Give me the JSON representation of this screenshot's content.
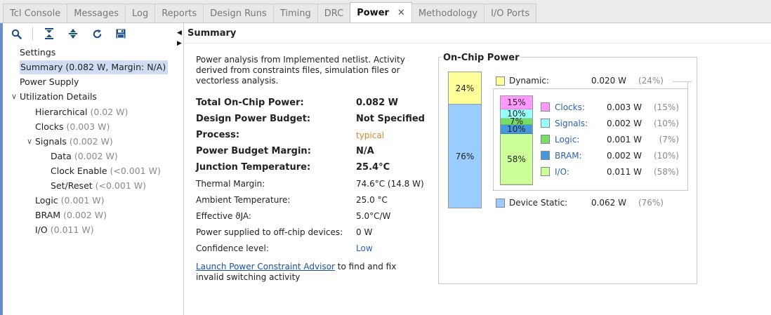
{
  "tabs": [
    {
      "label": "Tcl Console",
      "active": false
    },
    {
      "label": "Messages",
      "active": false
    },
    {
      "label": "Log",
      "active": false
    },
    {
      "label": "Reports",
      "active": false
    },
    {
      "label": "Design Runs",
      "active": false
    },
    {
      "label": "Timing",
      "active": false
    },
    {
      "label": "DRC",
      "active": false
    },
    {
      "label": "Power",
      "active": true
    },
    {
      "label": "Methodology",
      "active": false
    },
    {
      "label": "I/O Ports",
      "active": false
    }
  ],
  "tab_close_glyph": "✕",
  "toolbar": {
    "icons": [
      "search-icon",
      "collapse-all-icon",
      "expand-all-icon",
      "refresh-icon",
      "save-icon"
    ]
  },
  "tree": {
    "settings": {
      "label": "Settings"
    },
    "summary": {
      "label": "Summary (0.082 W, Margin: N/A)"
    },
    "power_supply": {
      "label": "Power Supply"
    },
    "utilization": {
      "label": "Utilization Details"
    },
    "hierarchical": {
      "label": "Hierarchical",
      "value": "(0.02 W)"
    },
    "clocks": {
      "label": "Clocks",
      "value": "(0.003 W)"
    },
    "signals": {
      "label": "Signals",
      "value": "(0.002 W)"
    },
    "data": {
      "label": "Data",
      "value": "(0.002 W)"
    },
    "clock_enable": {
      "label": "Clock Enable",
      "value": "(<0.001 W)"
    },
    "set_reset": {
      "label": "Set/Reset",
      "value": "(<0.001 W)"
    },
    "logic": {
      "label": "Logic",
      "value": "(0.001 W)"
    },
    "bram": {
      "label": "BRAM",
      "value": "(0.002 W)"
    },
    "io": {
      "label": "I/O",
      "value": "(0.011 W)"
    }
  },
  "summary": {
    "title": "Summary",
    "description": "Power analysis from Implemented netlist. Activity derived from constraints files, simulation files or vectorless analysis.",
    "rows": [
      {
        "key": "Total On-Chip Power:",
        "value": "0.082 W"
      },
      {
        "key": "Design Power Budget:",
        "value": "Not Specified"
      },
      {
        "key": "Process:",
        "value": "typical"
      },
      {
        "key": "Power Budget Margin:",
        "value": "N/A"
      },
      {
        "key": "Junction Temperature:",
        "value": "25.4°C"
      },
      {
        "key": "Thermal Margin:",
        "value": "74.6°C (14.8 W)"
      },
      {
        "key": "Ambient Temperature:",
        "value": "25.0 °C"
      },
      {
        "key": "Effective ϑJA:",
        "value": "5.0°C/W"
      },
      {
        "key": "Power supplied to off-chip devices:",
        "value": "0 W"
      },
      {
        "key": "Confidence level:",
        "value": "Low"
      }
    ],
    "footer_link": "Launch Power Constraint Advisor",
    "footer_text": " to find and fix invalid switching activity"
  },
  "on_chip": {
    "title": "On-Chip Power",
    "dynamic": {
      "label": "Dynamic:",
      "value": "0.020 W",
      "pct": "(24%)",
      "bar_pct": "24%",
      "color": "#ffff99"
    },
    "static": {
      "label": "Device Static:",
      "value": "0.062 W",
      "pct": "(76%)",
      "bar_pct": "76%",
      "color": "#99ccff"
    },
    "breakdown": [
      {
        "label": "Clocks",
        "value": "0.003 W",
        "pct": "(15%)",
        "bar_pct": "15%",
        "color": "#ff99ff"
      },
      {
        "label": "Signals",
        "value": "0.002 W",
        "pct": "(10%)",
        "bar_pct": "10%",
        "color": "#99ffff"
      },
      {
        "label": "Logic",
        "value": "0.001 W",
        "pct": "(7%)",
        "bar_pct": "7%",
        "color": "#77dd66"
      },
      {
        "label": "BRAM",
        "value": "0.002 W",
        "pct": "(10%)",
        "bar_pct": "10%",
        "color": "#4499dd"
      },
      {
        "label": "I/O",
        "value": "0.011 W",
        "pct": "(58%)",
        "bar_pct": "58%",
        "color": "#ccff99"
      }
    ]
  }
}
